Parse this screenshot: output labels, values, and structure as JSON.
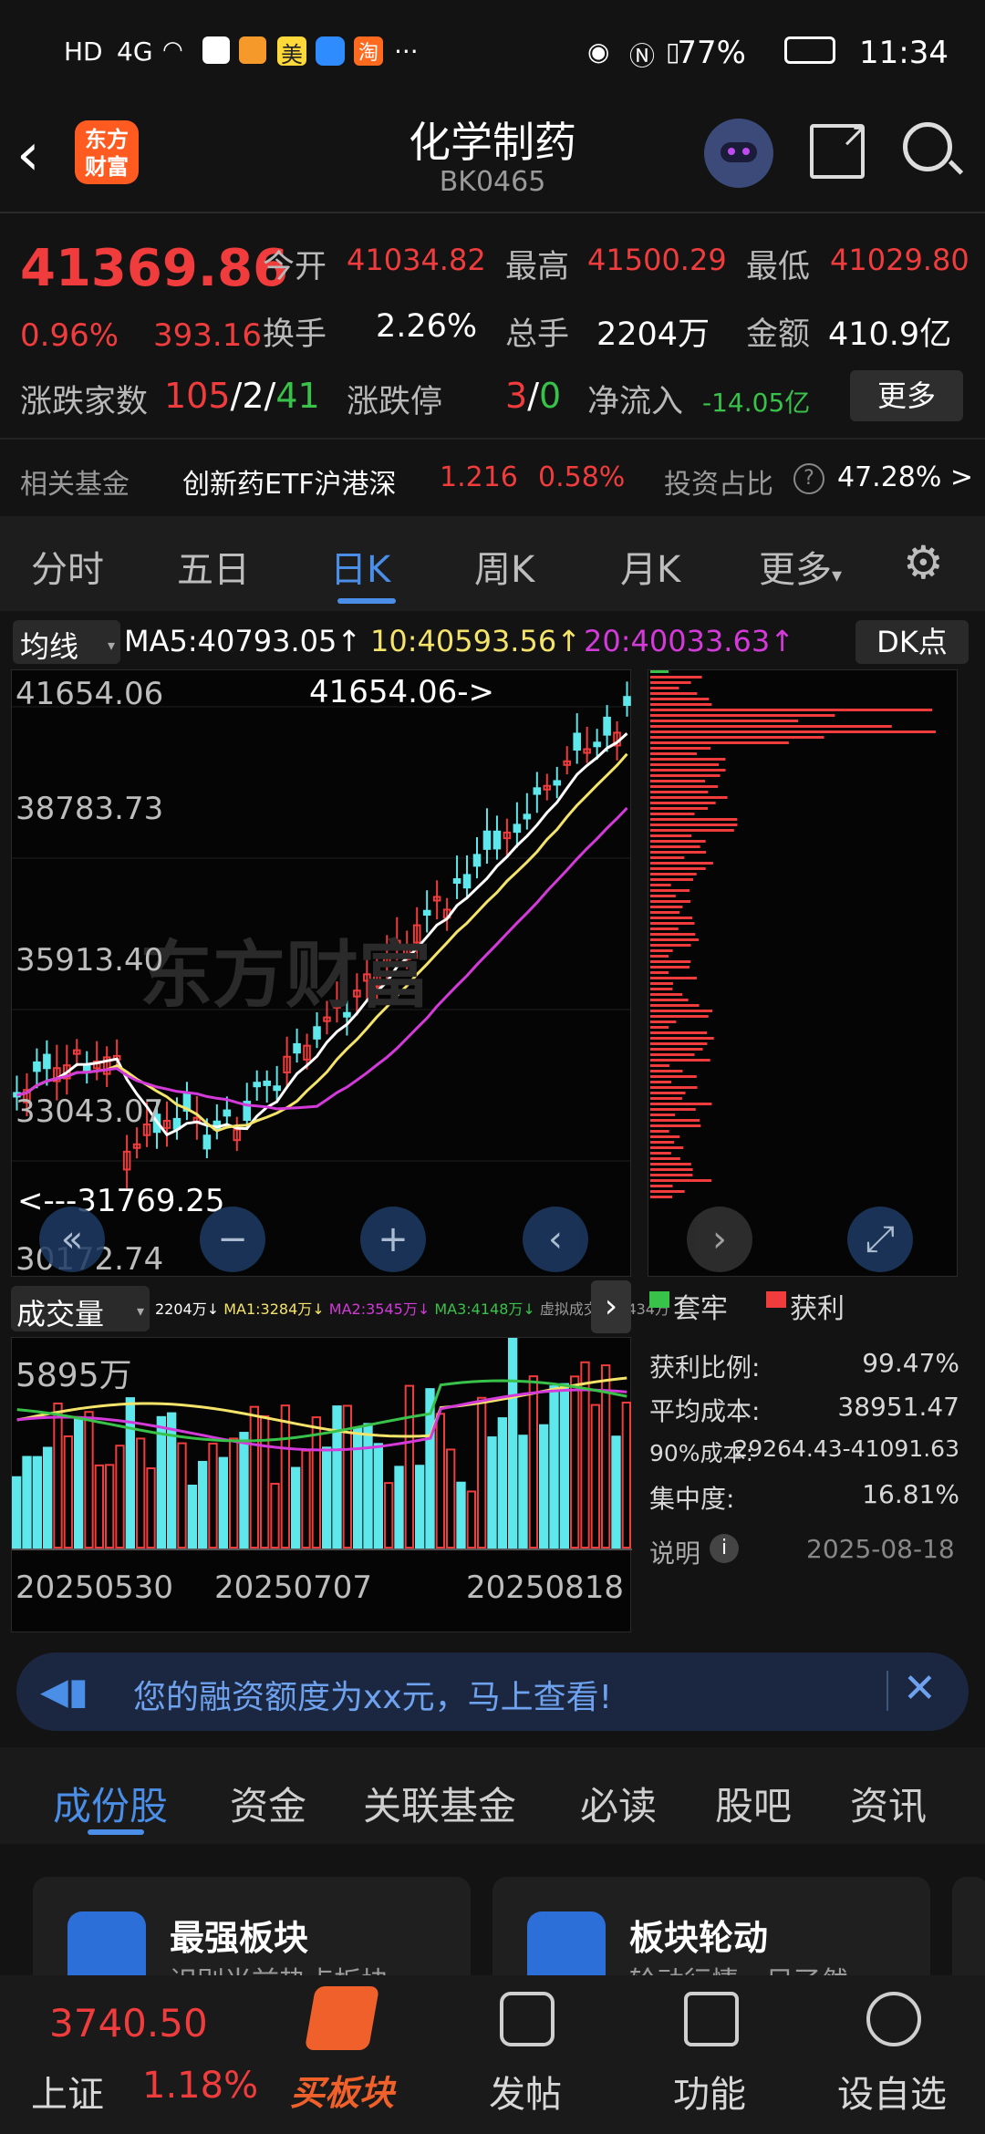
{
  "status_bar": {
    "left_icons": [
      "HD",
      "4G",
      "signal",
      "wifi",
      "app-icon",
      "app-icon",
      "美",
      "app-icon",
      "淘"
    ],
    "more": "···",
    "battery": "77%",
    "time": "11:34"
  },
  "header": {
    "logo_text_top": "东方",
    "logo_text_bottom": "财富",
    "title": "化学制药",
    "code": "BK0465"
  },
  "quote": {
    "price": "41369.86",
    "change_pct": "0.96%",
    "change_val": "393.16",
    "open_label": "今开",
    "open": "41034.82",
    "high_label": "最高",
    "high": "41500.29",
    "low_label": "最低",
    "low": "41029.80",
    "turnover_label": "换手",
    "turnover": "2.26%",
    "volume_label": "总手",
    "volume": "2204万",
    "amount_label": "金额",
    "amount": "410.9亿",
    "updown_label": "涨跌家数",
    "up_count": "105",
    "flat_count": "2",
    "down_count": "41",
    "limit_label": "涨跌停",
    "limit_up": "3",
    "limit_down": "0",
    "netflow_label": "净流入",
    "netflow": "-14.05亿",
    "more_button": "更多"
  },
  "fund": {
    "label": "相关基金",
    "name": "创新药ETF沪港深",
    "price": "1.216",
    "pct": "0.58%",
    "ratio_label": "投资占比",
    "ratio": "47.28% >"
  },
  "chart_tabs": [
    "分时",
    "五日",
    "日K",
    "周K",
    "月K",
    "更多"
  ],
  "active_tab": "日K",
  "ma_bar": {
    "selector": "均线",
    "ma5": "MA5:40793.05↑",
    "ma10": "10:40593.56↑",
    "ma20": "20:40033.63↑",
    "dk_button": "DK点"
  },
  "kline": {
    "y_labels": [
      "41654.06",
      "38783.73",
      "35913.40",
      "33043.07",
      "30172.74"
    ],
    "max_marker": "41654.06->",
    "min_marker": "<---31769.25",
    "watermark": "东方财富"
  },
  "volume_bar": {
    "selector": "成交量",
    "vol": "2204万↓",
    "ma1": "MA1:3284万↓",
    "ma2": "MA2:3545万↓",
    "ma3": "MA3:4148万↓",
    "virtual": "虚拟成交量:3434万",
    "y_label": "5895万",
    "dates": [
      "20250530",
      "20250707",
      "20250818"
    ]
  },
  "chip": {
    "legend_trapped": "套牢",
    "legend_profit": "获利",
    "rows": [
      {
        "label": "获利比例:",
        "value": "99.47%"
      },
      {
        "label": "平均成本:",
        "value": "38951.47"
      },
      {
        "label": "90%成本:",
        "value": "29264.43-41091.63"
      },
      {
        "label": "集中度:",
        "value": "16.81%"
      }
    ],
    "note_label": "说明",
    "date": "2025-08-18"
  },
  "banner": {
    "text": "您的融资额度为xx元，马上查看!"
  },
  "sub_tabs": [
    "成份股",
    "资金",
    "关联基金",
    "必读",
    "股吧",
    "资讯"
  ],
  "cards": [
    {
      "title": "最强板块",
      "subtitle": "识别当前热点板块"
    },
    {
      "title": "板块轮动",
      "subtitle": "轮动行情一目了然"
    }
  ],
  "bottom_nav": {
    "index_value": "3740.50",
    "index_name": "上证",
    "index_pct": "1.18%",
    "buy_label": "买板块",
    "post_label": "发帖",
    "func_label": "功能",
    "fav_label": "设自选"
  },
  "colors": {
    "up": "#f03c3c",
    "down": "#5fe8ec",
    "ma5": "#ffffff",
    "ma10": "#f5e46a",
    "ma20": "#d33ad9",
    "accent": "#4b8ee8"
  }
}
